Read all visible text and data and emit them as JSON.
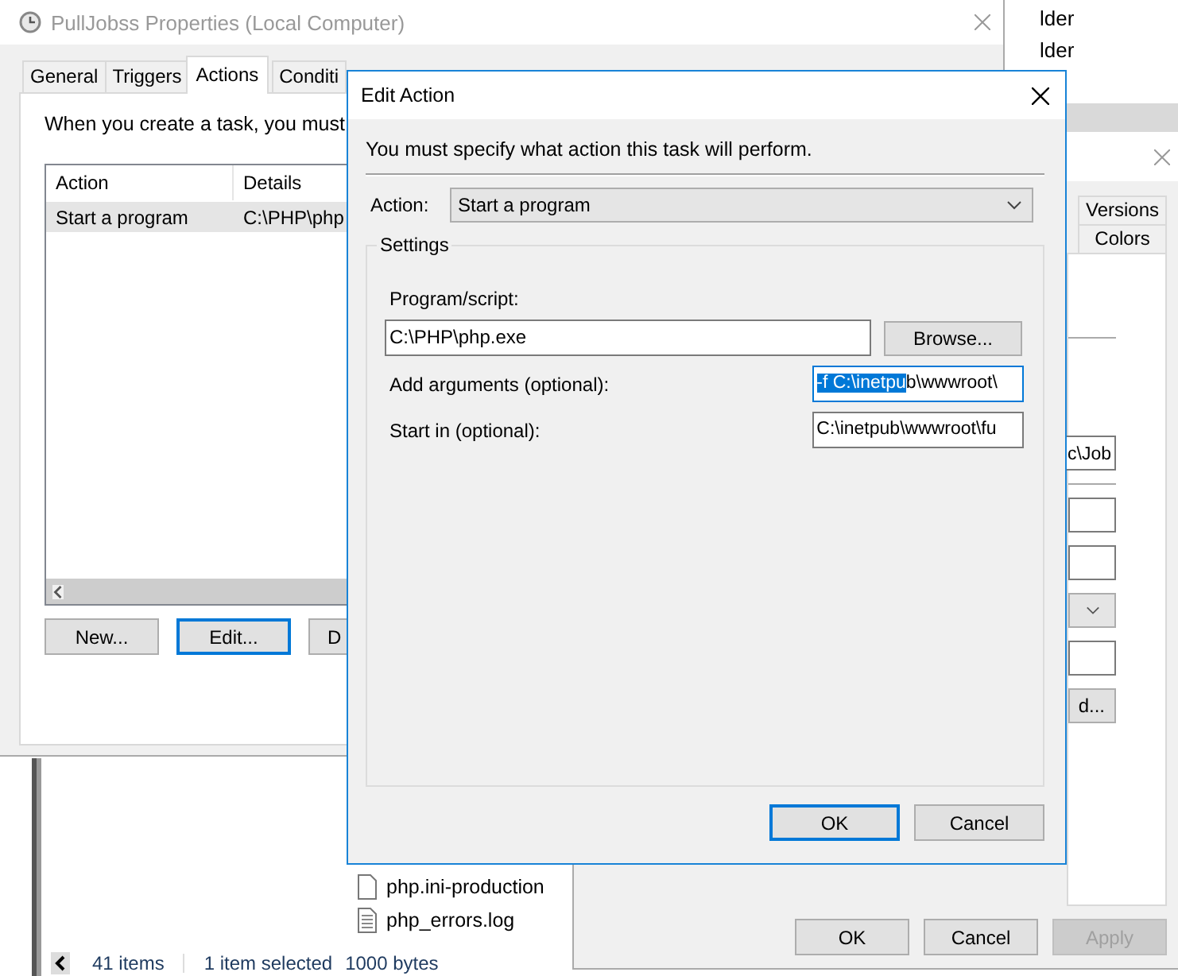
{
  "explorer": {
    "folder_items": [
      {
        "label": "lder"
      },
      {
        "label": "lder"
      }
    ],
    "files": [
      {
        "name": "php.ini-production",
        "kind": "file"
      },
      {
        "name": "php_errors.log",
        "kind": "text"
      }
    ],
    "status_bar": {
      "item_count": "41 items",
      "selection": "1 item selected",
      "size": "1000 bytes"
    }
  },
  "properties_window": {
    "title": "PullJobss Properties (Local Computer)",
    "active": false,
    "tabs": [
      {
        "label": "General",
        "selected": false
      },
      {
        "label": "Triggers",
        "selected": false
      },
      {
        "label": "Actions",
        "selected": true
      },
      {
        "label": "Conditi",
        "selected": false
      }
    ],
    "intro": "When you create a task, you must",
    "list": {
      "columns": [
        "Action",
        "Details"
      ],
      "rows": [
        {
          "action": "Start a program",
          "details": "C:\\PHP\\php",
          "selected": true
        }
      ]
    },
    "buttons": [
      {
        "label": "New...",
        "focused": false
      },
      {
        "label": "Edit...",
        "focused": true
      },
      {
        "label": "D",
        "focused": false
      }
    ]
  },
  "second_window": {
    "tabs": [
      {
        "label": "Versions",
        "selected": false
      },
      {
        "label": "Colors",
        "selected": false
      }
    ],
    "fields": [
      {
        "kind": "text",
        "value": "c\\Job"
      },
      {
        "kind": "text"
      },
      {
        "kind": "text"
      },
      {
        "kind": "dropdown"
      },
      {
        "kind": "text"
      },
      {
        "kind": "button",
        "label": "d..."
      }
    ],
    "buttons": [
      {
        "label": "OK",
        "disabled": false
      },
      {
        "label": "Cancel",
        "disabled": false
      },
      {
        "label": "Apply",
        "disabled": true
      }
    ]
  },
  "edit_action": {
    "title": "Edit Action",
    "instruction": "You must specify what action this task will perform.",
    "action_label": "Action:",
    "action_value": "Start a program",
    "settings_label": "Settings",
    "program_label": "Program/script:",
    "program_value": "C:\\PHP\\php.exe",
    "browse": "Browse...",
    "arguments_label": "Add arguments (optional):",
    "arguments_selected": "-f C:\\inetpu",
    "arguments_rest": "b\\wwwroot\\",
    "start_in_label": "Start in (optional):",
    "start_in_value": "C:\\inetpub\\wwwroot\\fu",
    "buttons": [
      {
        "label": "OK",
        "focused": true
      },
      {
        "label": "Cancel",
        "focused": false
      }
    ]
  }
}
